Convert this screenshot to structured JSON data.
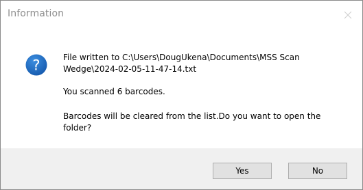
{
  "window": {
    "title": "Information",
    "close_icon": "close-icon"
  },
  "message": {
    "icon": "question-icon",
    "line1": "File written to C:\\Users\\DougUkena\\Documents\\MSS Scan Wedge\\2024-02-05-11-47-14.txt",
    "line2": "You scanned 6 barcodes.",
    "line3": "Barcodes will be cleared from the list.Do you want to open the folder?"
  },
  "buttons": {
    "yes_label": "Yes",
    "no_label": "No"
  },
  "colors": {
    "icon_blue": "#1f6fc5",
    "footer_bg": "#f0f0f0",
    "button_bg": "#e1e1e1",
    "button_border": "#adadad"
  }
}
